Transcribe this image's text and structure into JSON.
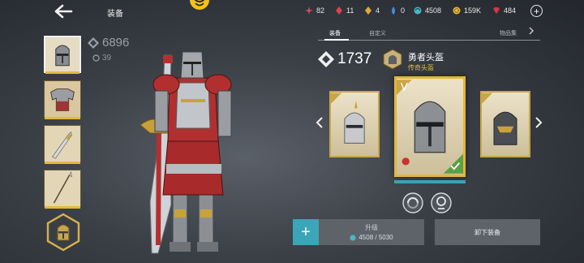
{
  "header": {
    "title": "装备"
  },
  "resources": [
    {
      "icon": "red-star-icon",
      "value": "82",
      "color": "#e0505a"
    },
    {
      "icon": "red-gem-icon",
      "value": "11",
      "color": "#d9434f"
    },
    {
      "icon": "gold-gem-icon",
      "value": "4",
      "color": "#e0a93c"
    },
    {
      "icon": "blue-drop-icon",
      "value": "0",
      "color": "#3f8fe0"
    },
    {
      "icon": "teal-orb-icon",
      "value": "4508",
      "color": "#4bb6c4"
    },
    {
      "icon": "coin-icon",
      "value": "159K",
      "color": "#e6b83c"
    },
    {
      "icon": "ruby-icon",
      "value": "484",
      "color": "#d8344a"
    }
  ],
  "character": {
    "power": "6896",
    "level": "39"
  },
  "tabs": [
    {
      "label": "装备",
      "active": true
    },
    {
      "label": "自定义",
      "active": false
    },
    {
      "label": "物品集",
      "active": false
    }
  ],
  "item": {
    "power": "1737",
    "name": "勇者头盔",
    "rarity": "传奇头盔",
    "rarity_color": "#e0b948"
  },
  "upgrade": {
    "label": "升级",
    "cost": "4508 / 5030"
  },
  "unequip": {
    "label": "卸下装备"
  },
  "colors": {
    "accent_teal": "#3aa6b8",
    "gold": "#e2b63d",
    "button_bg": "#5d6369"
  }
}
